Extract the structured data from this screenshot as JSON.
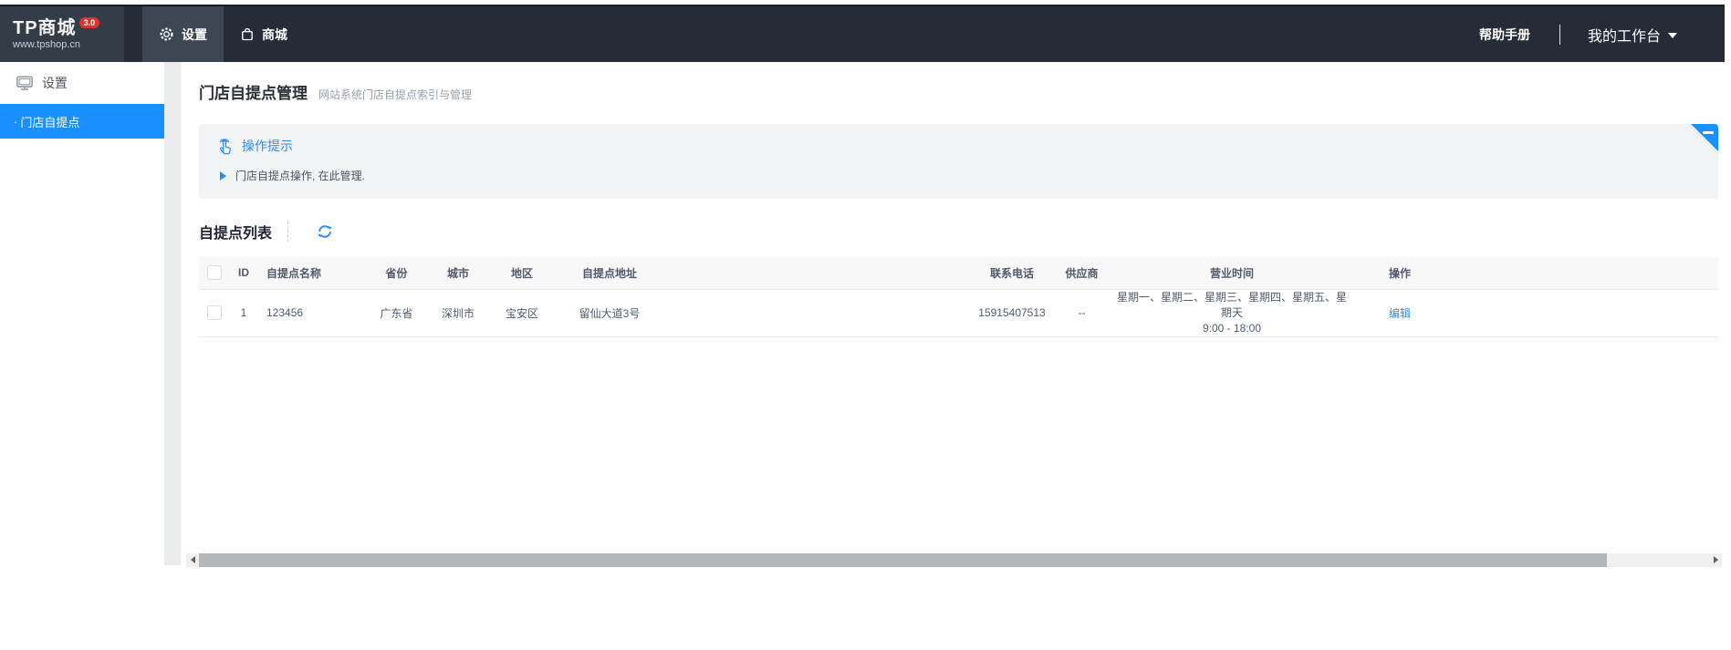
{
  "navbar": {
    "logo_title": "TP商城",
    "logo_badge": "3.0",
    "logo_domain": "www.tpshop.cn",
    "tab_settings": "设置",
    "tab_mall": "商城",
    "help_label": "帮助手册",
    "workspace_label": "我的工作台"
  },
  "sidebar": {
    "header": "设置",
    "item_bullet": "·",
    "item_label": "门店自提点"
  },
  "page": {
    "title": "门店自提点管理",
    "subtitle": "网站系统门店自提点索引与管理"
  },
  "tips": {
    "title": "操作提示",
    "item": "门店自提点操作, 在此管理."
  },
  "list_section": {
    "title": "自提点列表"
  },
  "table": {
    "columns": [
      "ID",
      "自提点名称",
      "省份",
      "城市",
      "地区",
      "自提点地址",
      "联系电话",
      "供应商",
      "营业时间",
      "操作"
    ],
    "rows": [
      {
        "id": "1",
        "name": "123456",
        "province": "广东省",
        "city": "深圳市",
        "district": "宝安区",
        "address": "留仙大道3号",
        "phone": "15915407513",
        "supplier": "--",
        "business_days": "星期一、星期二、星期三、星期四、星期五、星期天",
        "business_hours": "9:00 - 18:00",
        "action": "编辑"
      }
    ]
  },
  "colors": {
    "accent_blue": "#2d8cf0",
    "sidebar_active_blue": "#1890ff",
    "navbar_bg": "#252b37",
    "tips_bg": "#f2f3f5",
    "badge_red": "#e03131"
  }
}
